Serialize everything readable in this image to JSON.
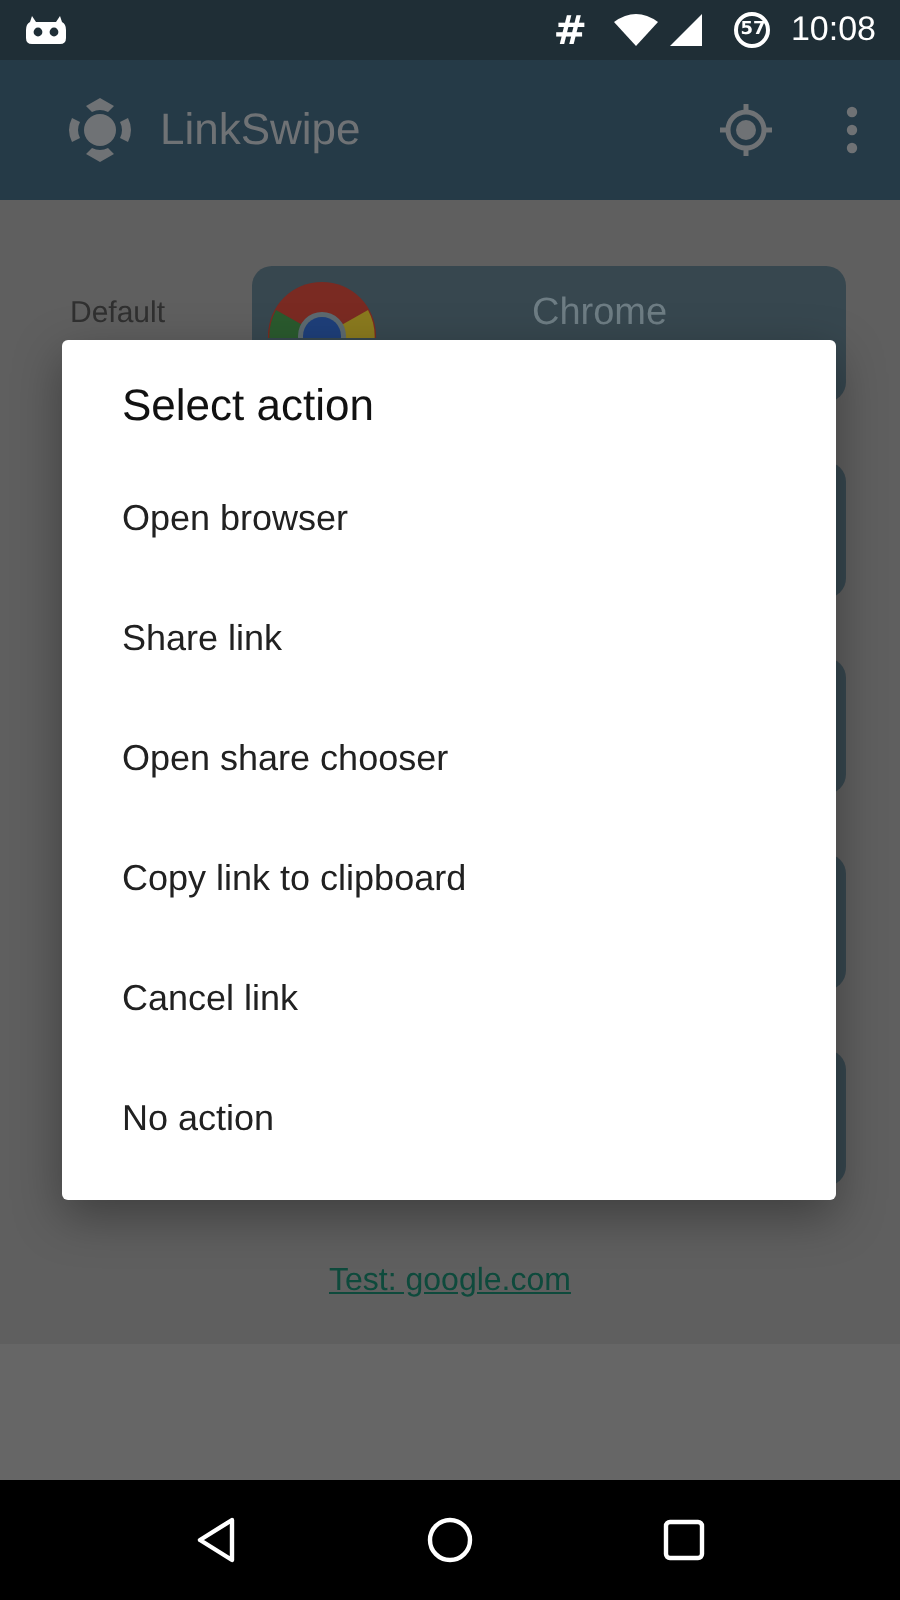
{
  "status_bar": {
    "hash": "#",
    "battery": "57",
    "time": "10:08"
  },
  "toolbar": {
    "title": "LinkSwipe"
  },
  "rows": [
    {
      "label": "Default",
      "card": "Chrome",
      "kind": "browser"
    },
    {
      "kind": "blank"
    },
    {
      "kind": "blank"
    },
    {
      "kind": "blank"
    },
    {
      "kind": "blank"
    }
  ],
  "test_link": "Test: google.com",
  "dialog": {
    "title": "Select action",
    "items": [
      "Open browser",
      "Share link",
      "Open share chooser",
      "Copy link to clipboard",
      "Cancel link",
      "No action"
    ]
  }
}
